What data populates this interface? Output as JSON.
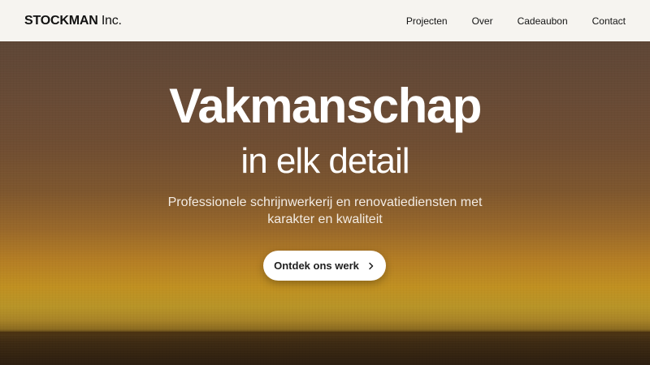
{
  "header": {
    "brand_strong": "STOCKMAN",
    "brand_light": "Inc.",
    "nav": [
      {
        "label": "Projecten"
      },
      {
        "label": "Over"
      },
      {
        "label": "Cadeaubon"
      },
      {
        "label": "Contact"
      }
    ]
  },
  "hero": {
    "title": "Vakmanschap",
    "subtitle": "in elk detail",
    "description": "Professionele schrijnwerkerij en renovatiediensten met karakter en kwaliteit",
    "cta_label": "Ontdek ons werk",
    "cta_icon": "chevron-right-icon"
  },
  "colors": {
    "header_bg": "#f6f4f0",
    "text_dark": "#111111",
    "hero_text": "#ffffff",
    "cta_bg": "#ffffff"
  }
}
